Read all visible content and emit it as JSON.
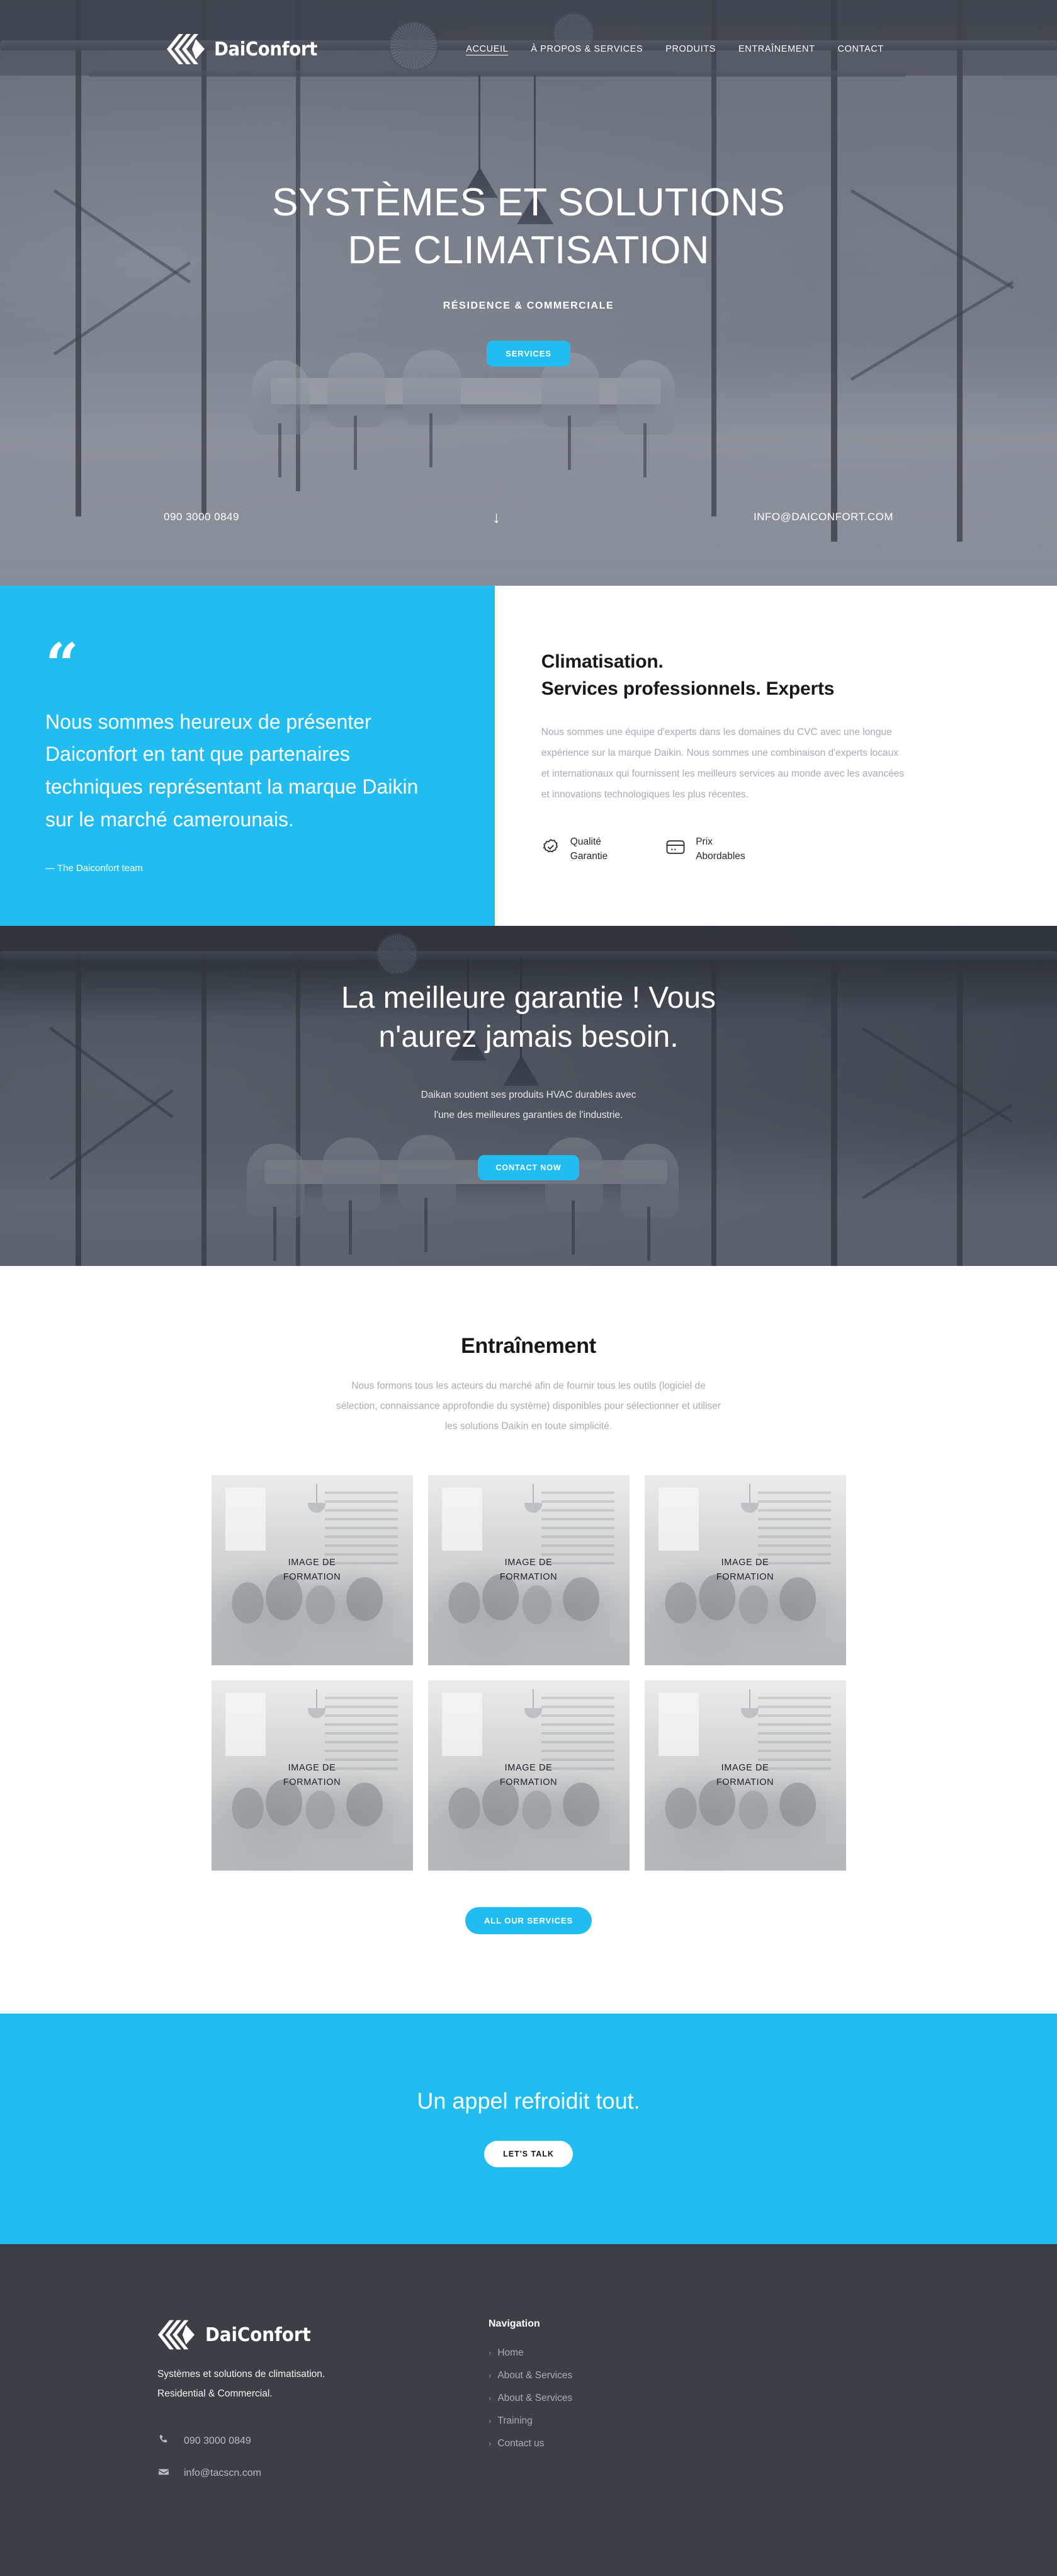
{
  "colors": {
    "accent": "#22bdf0",
    "footer_bg": "#3c4046",
    "muted_text": "#a7abb2"
  },
  "header": {
    "logo_icon": "daiconfort-chevron-logo",
    "brand": "DaiConfort",
    "nav": [
      {
        "label": "ACCUEIL",
        "active": true
      },
      {
        "label": "À PROPOS & SERVICES",
        "active": false
      },
      {
        "label": "PRODUITS",
        "active": false
      },
      {
        "label": "ENTRAÎNEMENT",
        "active": false
      },
      {
        "label": "CONTACT",
        "active": false
      }
    ]
  },
  "hero": {
    "title_line1": "SYSTÈMES ET SOLUTIONS",
    "title_line2": "DE CLIMATISATION",
    "subtitle": "RÉSIDENCE & COMMERCIALE",
    "cta": "SERVICES",
    "phone": "090 3000 0849",
    "email": "INFO@DAICONFORT.COM",
    "scroll_icon": "arrow-down-icon",
    "scroll_glyph": "↓"
  },
  "quote": {
    "mark_icon": "quote-mark-icon",
    "mark_glyph": "“",
    "text": "Nous sommes heureux de présenter Daiconfort en tant que partenaires techniques représentant la marque Daikin sur le marché camerounais.",
    "author": "— The Daiconfort team"
  },
  "about": {
    "heading_line1": "Climatisation.",
    "heading_line2": "Services professionnels. Experts",
    "paragraph": "Nous sommes une équipe d'experts dans les domaines du CVC avec une longue expérience sur la marque Daikin. Nous sommes une combinaison d'experts locaux et internationaux qui fournissent les meilleurs services au monde avec les avancées et innovations technologiques les plus récentes.",
    "features": [
      {
        "icon": "verified-badge-icon",
        "line1": "Qualité",
        "line2": "Garantie"
      },
      {
        "icon": "credit-card-icon",
        "line1": "Prix",
        "line2": "Abordables"
      }
    ]
  },
  "guarantee": {
    "title_line1": "La meilleure garantie ! Vous",
    "title_line2": "n'aurez jamais besoin.",
    "paragraph_line1": "Daikan soutient ses produits HVAC durables avec",
    "paragraph_line2": "l'une des meilleures garanties de l'industrie.",
    "cta": "CONTACT NOW"
  },
  "training": {
    "title": "Entraînement",
    "paragraph": "Nous formons tous les acteurs du marché afin de fournir tous les outils (logiciel de sélection, connaissance approfondie du système) disponibles pour sélectionner et utiliser les solutions Daikin en toute simplicité.",
    "cards": [
      {
        "caption_line1": "IMAGE DE",
        "caption_line2": "FORMATION"
      },
      {
        "caption_line1": "IMAGE DE",
        "caption_line2": "FORMATION"
      },
      {
        "caption_line1": "IMAGE DE",
        "caption_line2": "FORMATION"
      },
      {
        "caption_line1": "IMAGE DE",
        "caption_line2": "FORMATION"
      },
      {
        "caption_line1": "IMAGE DE",
        "caption_line2": "FORMATION"
      },
      {
        "caption_line1": "IMAGE DE",
        "caption_line2": "FORMATION"
      }
    ],
    "cta": "ALL OUR SERVICES"
  },
  "cta_band": {
    "title": "Un appel refroidit tout.",
    "button": "LET'S TALK"
  },
  "footer": {
    "logo_icon": "daiconfort-chevron-logo",
    "brand": "DaiConfort",
    "description": "Systèmes et solutions de climatisation. Residential & Commercial.",
    "phone_icon": "phone-icon",
    "phone": "090 3000 0849",
    "email_icon": "envelope-icon",
    "email": "info@tacscn.com",
    "nav_title": "Navigation",
    "nav_items": [
      {
        "label": "Home",
        "chevron": "›"
      },
      {
        "label": "About & Services",
        "chevron": "›"
      },
      {
        "label": "About & Services",
        "chevron": "›"
      },
      {
        "label": "Training",
        "chevron": "›"
      },
      {
        "label": "Contact us",
        "chevron": "›"
      }
    ]
  }
}
